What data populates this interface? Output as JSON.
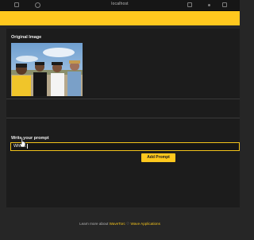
{
  "window": {
    "title": "localhost"
  },
  "original_image": {
    "label": "Original Image"
  },
  "prompt": {
    "label": "Write your prompt",
    "value": "Whats"
  },
  "add_button": {
    "label": "Add Prompt"
  },
  "footer": {
    "text": "Learn more about",
    "link_wavetorc": "WaveTorc",
    "link_apps": "Wave Applications"
  },
  "colors": {
    "accent": "#ffc81e",
    "background": "#262626",
    "panel": "#1c1c1c"
  }
}
